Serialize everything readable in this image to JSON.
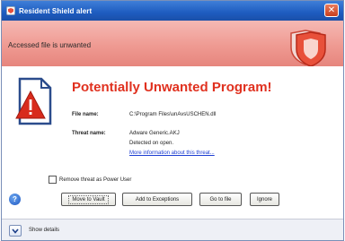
{
  "window": {
    "title": "Resident Shield alert",
    "close_glyph": "✕"
  },
  "banner": {
    "text": "Accessed file is unwanted",
    "icon": "shield-icon"
  },
  "alert": {
    "heading": "Potentially Unwanted Program!",
    "icon": "warning-document-icon",
    "file_label": "File name:",
    "file_value": "C:\\Program Files\\unAvsUSCHEN.dll",
    "threat_label": "Threat name:",
    "threat_value": "Adware Generic.AKJ",
    "detected_text": "Detected on open.",
    "more_info_link": "More information about this threat..."
  },
  "options": {
    "power_user_checkbox": "Remove threat as Power User",
    "checked": false
  },
  "buttons": {
    "help": "?",
    "move_to_vault": "Move to Vault",
    "add_exceptions": "Add to Exceptions",
    "go_to_file": "Go to file",
    "ignore": "Ignore"
  },
  "footer": {
    "show_details": "Show details"
  },
  "colors": {
    "titlebar": "#1e5cc0",
    "banner": "#ef9a92",
    "heading": "#e0311f",
    "link": "#1e3fd2",
    "shield": "#e8503a"
  }
}
